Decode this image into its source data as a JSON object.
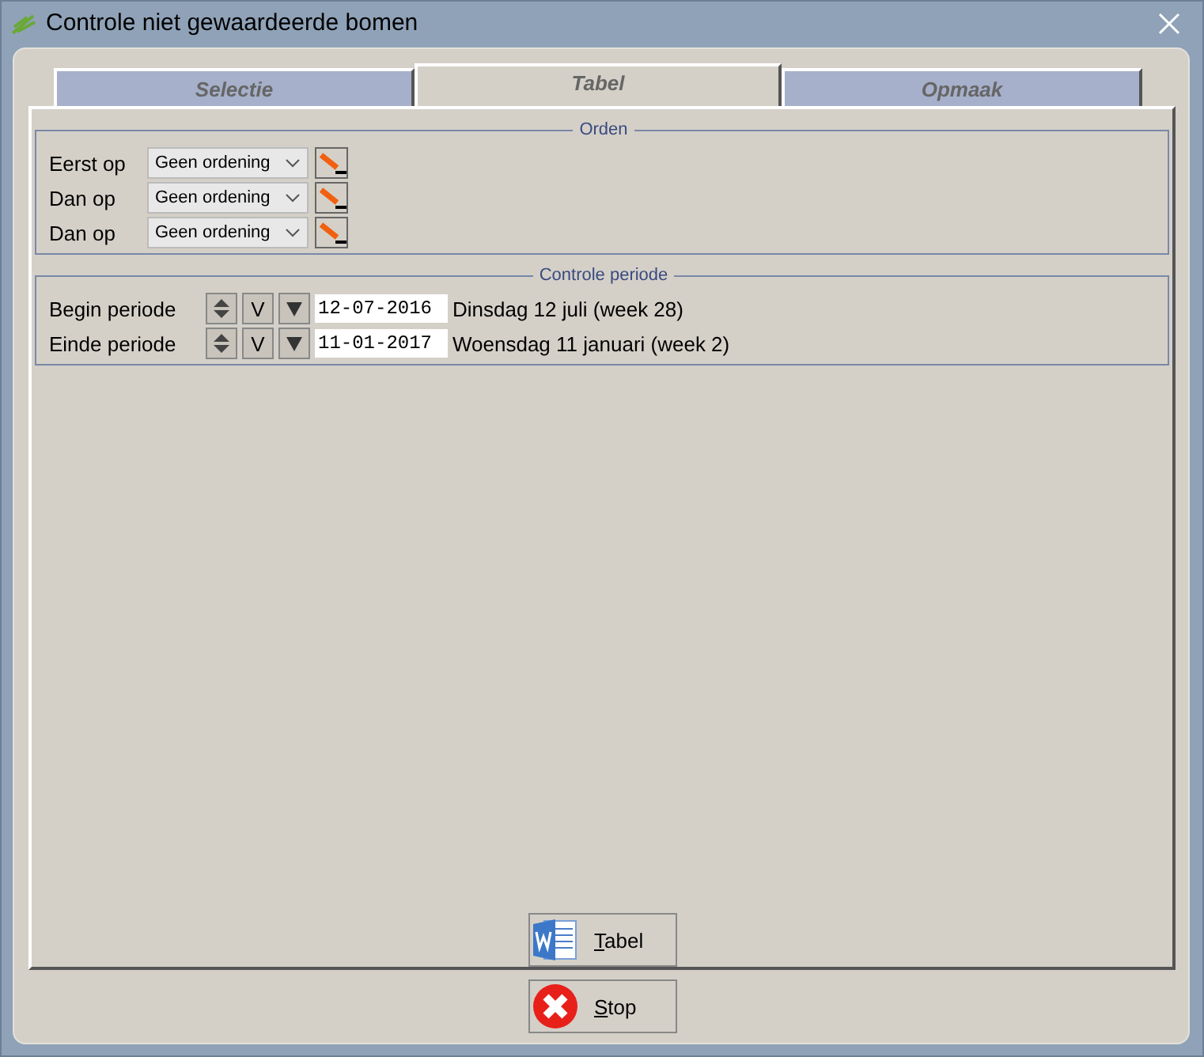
{
  "window": {
    "title": "Controle niet gewaardeerde bomen"
  },
  "tabs": [
    {
      "label": "Selectie",
      "selected": false
    },
    {
      "label": "Tabel",
      "selected": true
    },
    {
      "label": "Opmaak",
      "selected": false
    }
  ],
  "orden": {
    "title": "Orden",
    "rows": [
      {
        "label": "Eerst op",
        "value": "Geen ordening"
      },
      {
        "label": "Dan op",
        "value": "Geen ordening"
      },
      {
        "label": "Dan op",
        "value": "Geen ordening"
      }
    ]
  },
  "periode": {
    "title": "Controle periode",
    "rows": [
      {
        "label": "Begin periode",
        "v_button": "V",
        "date": "12-07-2016",
        "description": "Dinsdag 12 juli (week 28)"
      },
      {
        "label": "Einde periode",
        "v_button": "V",
        "date": "11-01-2017",
        "description": "Woensdag 11 januari (week 2)"
      }
    ]
  },
  "buttons": [
    {
      "kind": "word",
      "label": "Tabel"
    },
    {
      "kind": "stop",
      "label": "Stop"
    }
  ]
}
